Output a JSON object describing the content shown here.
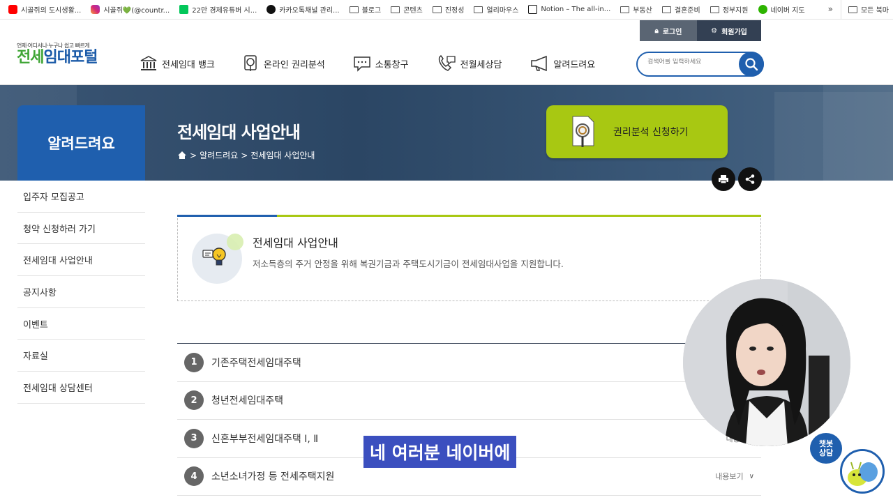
{
  "bookmarks": [
    {
      "label": "시골쥐의 도시생활...",
      "icon": "youtube-icon"
    },
    {
      "label": "시골쥐💚(@countr...",
      "icon": "instagram-icon"
    },
    {
      "label": "22만 경제유튜버 시...",
      "icon": "naver-icon"
    },
    {
      "label": "카카오톡채널 관리...",
      "icon": "kakao-icon"
    },
    {
      "label": "블로그",
      "icon": "folder-icon"
    },
    {
      "label": "콘텐츠",
      "icon": "folder-icon"
    },
    {
      "label": "진정성",
      "icon": "folder-icon"
    },
    {
      "label": "얼리마우스",
      "icon": "folder-icon"
    },
    {
      "label": "Notion – The all-in...",
      "icon": "notion-icon"
    },
    {
      "label": "부동산",
      "icon": "folder-icon"
    },
    {
      "label": "결혼준비",
      "icon": "folder-icon"
    },
    {
      "label": "정부지원",
      "icon": "folder-icon"
    },
    {
      "label": "네이버 지도",
      "icon": "map-icon"
    }
  ],
  "bookmarks_more": "»",
  "bookmarks_all": "모든 북마",
  "header": {
    "login": "로그인",
    "join": "회원가입",
    "logo_sub": "언제·어디서나·누구나 쉽고 빠르게",
    "logo_a": "전세",
    "logo_b": "임대포털",
    "nav": [
      {
        "label": "전세임대 뱅크",
        "icon": "bank-icon"
      },
      {
        "label": "온라인 권리분석",
        "icon": "analysis-icon"
      },
      {
        "label": "소통창구",
        "icon": "chat-icon"
      },
      {
        "label": "전월세상담",
        "icon": "phone-icon"
      },
      {
        "label": "알려드려요",
        "icon": "megaphone-icon"
      }
    ],
    "search_placeholder": "검색어를 입력하세요"
  },
  "banner": {
    "section": "알려드려요",
    "title": "전세임대 사업안내",
    "crumb1": "알려드려요",
    "crumb2": "전세임대 사업안내",
    "sep": ">",
    "apply": "권리분석 신청하기"
  },
  "sidebar": [
    "입주자 모집공고",
    "청약 신청하러 가기",
    "전세임대 사업안내",
    "공지사항",
    "이벤트",
    "자료실",
    "전세임대 상담센터"
  ],
  "intro": {
    "title": "전세임대 사업안내",
    "desc": "저소득층의 주거 안정을 위해 복권기금과 주택도시기금이 전세임대사업을 지원합니다."
  },
  "programs": [
    {
      "num": "1",
      "label": "기존주택전세임대주택",
      "more": ""
    },
    {
      "num": "2",
      "label": "청년전세임대주택",
      "more": ""
    },
    {
      "num": "3",
      "label": "신혼부부전세임대주택 Ⅰ, Ⅱ",
      "more": "내용보기"
    },
    {
      "num": "4",
      "label": "소년소녀가정 등 전세주택지원",
      "more": "내용보기"
    }
  ],
  "subtitle": "네 여러분 네이버에",
  "chatbot": {
    "line1": "챗봇",
    "line2": "상담"
  },
  "colors": {
    "primary": "#1f5fae",
    "accent": "#a8c812",
    "banner": "#2b4664"
  }
}
